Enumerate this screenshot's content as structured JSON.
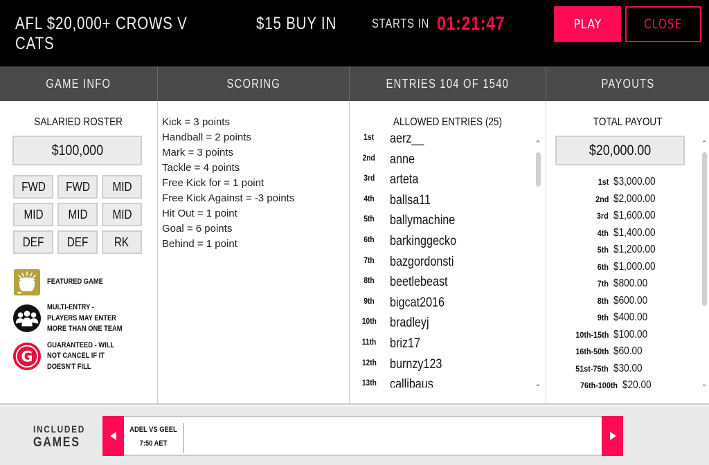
{
  "header": {
    "title": "AFL $20,000+ CROWS V CATS",
    "buy_in": "$15 BUY IN",
    "starts_in_label": "STARTS IN",
    "countdown": "01:21:47",
    "play_label": "PLAY",
    "close_label": "CLOSE"
  },
  "tabs": {
    "game_info": "GAME INFO",
    "scoring": "SCORING",
    "entries": "ENTRIES 104 OF 1540",
    "payouts": "PAYOUTS"
  },
  "game_info": {
    "roster_title": "SALARIED ROSTER",
    "salary_cap": "$100,000",
    "positions": [
      "FWD",
      "FWD",
      "MID",
      "MID",
      "MID",
      "MID",
      "DEF",
      "DEF",
      "RK"
    ],
    "legend": [
      {
        "icon": "pot-of-gold-icon",
        "text": "FEATURED GAME"
      },
      {
        "icon": "multi-entry-icon",
        "text": "MULTI-ENTRY - PLAYERS MAY ENTER MORE THAN ONE TEAM"
      },
      {
        "icon": "guaranteed-icon",
        "text": "GUARANTEED - WILL NOT CANCEL IF IT DOESN'T FILL"
      }
    ]
  },
  "scoring": {
    "rules": [
      "Kick = 3 points",
      "Handball = 2 points",
      "Mark = 3 points",
      "Tackle = 4 points",
      "Free Kick for = 1 point",
      "Free Kick Against = -3 points",
      "Hit Out = 1 point",
      "Goal = 6 points",
      "Behind = 1 point"
    ]
  },
  "entries": {
    "allowed_label": "ALLOWED ENTRIES (25)",
    "list": [
      {
        "rank": "1st",
        "name": "aerz__"
      },
      {
        "rank": "2nd",
        "name": "anne"
      },
      {
        "rank": "3rd",
        "name": "arteta"
      },
      {
        "rank": "4th",
        "name": "ballsa11"
      },
      {
        "rank": "5th",
        "name": "ballymachine"
      },
      {
        "rank": "6th",
        "name": "barkinggecko"
      },
      {
        "rank": "7th",
        "name": "bazgordonsti"
      },
      {
        "rank": "8th",
        "name": "beetlebeast"
      },
      {
        "rank": "9th",
        "name": "bigcat2016"
      },
      {
        "rank": "10th",
        "name": "bradleyj"
      },
      {
        "rank": "11th",
        "name": "briz17"
      },
      {
        "rank": "12th",
        "name": "burnzy123"
      },
      {
        "rank": "13th",
        "name": "callibaus"
      }
    ]
  },
  "payouts": {
    "total_label": "TOTAL PAYOUT",
    "total": "$20,000.00",
    "list": [
      {
        "rank": "1st",
        "amount": "$3,000.00"
      },
      {
        "rank": "2nd",
        "amount": "$2,000.00"
      },
      {
        "rank": "3rd",
        "amount": "$1,600.00"
      },
      {
        "rank": "4th",
        "amount": "$1,400.00"
      },
      {
        "rank": "5th",
        "amount": "$1,200.00"
      },
      {
        "rank": "6th",
        "amount": "$1,000.00"
      },
      {
        "rank": "7th",
        "amount": "$800.00"
      },
      {
        "rank": "8th",
        "amount": "$600.00"
      },
      {
        "rank": "9th",
        "amount": "$400.00"
      },
      {
        "rank": "10th-15th",
        "amount": "$100.00"
      },
      {
        "rank": "16th-50th",
        "amount": "$60.00"
      },
      {
        "rank": "51st-75th",
        "amount": "$30.00"
      },
      {
        "rank": "76th-100th",
        "amount": "$20.00"
      }
    ]
  },
  "included_games": {
    "label_line1": "INCLUDED",
    "label_line2": "GAMES",
    "games": [
      {
        "matchup": "ADEL VS GEEL",
        "time": "7:50 AET"
      }
    ]
  },
  "colors": {
    "accent": "#ff0a54",
    "header_bg": "#000000",
    "tab_bg": "#4a4a4a",
    "featured_gold": "#b5a23a"
  }
}
